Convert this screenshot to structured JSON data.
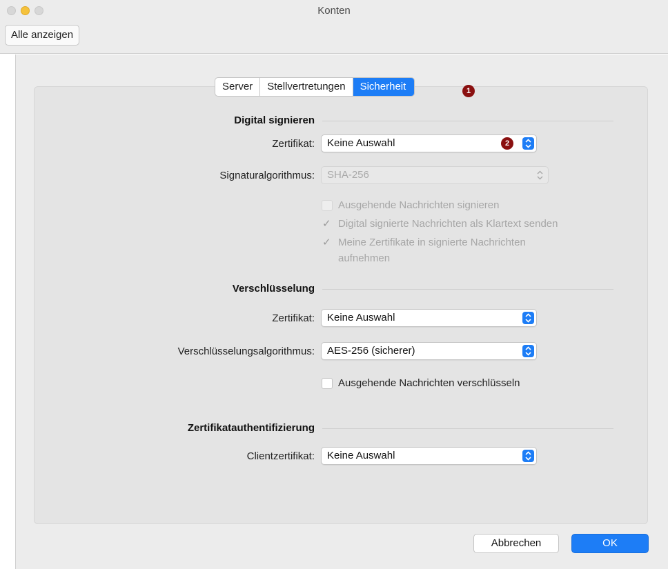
{
  "window": {
    "title": "Konten",
    "show_all_label": "Alle anzeigen"
  },
  "tabs": [
    {
      "label": "Server"
    },
    {
      "label": "Stellvertretungen"
    },
    {
      "label": "Sicherheit"
    }
  ],
  "badges": {
    "tab": "1",
    "certificate": "2"
  },
  "signing": {
    "heading": "Digital signieren",
    "certificate_label": "Zertifikat:",
    "certificate_value": "Keine Auswahl",
    "algorithm_label": "Signaturalgorithmus:",
    "algorithm_value": "SHA-256",
    "options": [
      {
        "label": "Ausgehende Nachrichten signieren",
        "checked": false
      },
      {
        "label": "Digital signierte Nachrichten als Klartext senden",
        "checked": true
      },
      {
        "label": "Meine Zertifikate in signierte Nachrichten",
        "label2": "aufnehmen",
        "checked": true
      }
    ]
  },
  "encryption": {
    "heading": "Verschlüsselung",
    "certificate_label": "Zertifikat:",
    "certificate_value": "Keine Auswahl",
    "algorithm_label": "Verschlüsselungsalgorithmus:",
    "algorithm_value": "AES-256 (sicherer)",
    "option_label": "Ausgehende Nachrichten verschlüsseln"
  },
  "cert_auth": {
    "heading": "Zertifikatauthentifizierung",
    "client_label": "Clientzertifikat:",
    "client_value": "Keine Auswahl"
  },
  "buttons": {
    "cancel": "Abbrechen",
    "ok": "OK"
  },
  "colors": {
    "accent": "#1d7df6",
    "badge": "#8a1010"
  }
}
